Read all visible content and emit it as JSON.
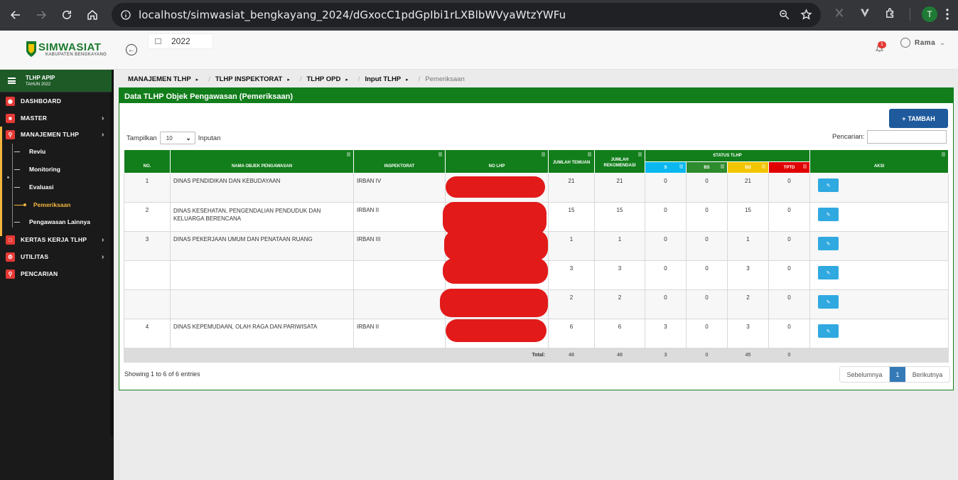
{
  "browser": {
    "url": "localhost/simwasiat_bengkayang_2024/dGxocC1pdGpIbi1rLXBlbWVyaWtzYWFu",
    "profile_initial": "T"
  },
  "header": {
    "logo_title": "SIMWASIAT",
    "logo_subtitle": "KABUPATEN BENGKAYANG",
    "year": "2022",
    "notif_count": "1",
    "user_name": "Rama"
  },
  "sidebar": {
    "head_title": "TLHP APIP",
    "head_sub": "TAHUN 2022",
    "items": [
      {
        "label": "DASHBOARD"
      },
      {
        "label": "MASTER"
      },
      {
        "label": "MANAJEMEN TLHP"
      },
      {
        "label": "KERTAS KERJA TLHP"
      },
      {
        "label": "UTILITAS"
      },
      {
        "label": "PENCARIAN"
      }
    ],
    "sub_items": [
      {
        "label": "Reviu"
      },
      {
        "label": "Monitoring"
      },
      {
        "label": "Evaluasi"
      },
      {
        "label": "Pemeriksaan"
      },
      {
        "label": "Pengawasan Lainnya"
      }
    ]
  },
  "breadcrumb": [
    "MANAJEMEN TLHP",
    "TLHP INSPEKTORAT",
    "TLHP OPD",
    "Input TLHP",
    "Pemeriksaan"
  ],
  "panel": {
    "title": "Data TLHP Objek Pengawasan (Pemeriksaan)",
    "add_label": "TAMBAH",
    "length_label_pre": "Tampilkan",
    "length_value": "10",
    "length_label_post": "Inputan",
    "search_label": "Pencarian:"
  },
  "table": {
    "headers": {
      "no": "NO.",
      "nama": "NAMA OBJEK PENGAWASAN",
      "inspektorat": "INSPEKTORAT",
      "no_lhp": "NO LHP",
      "jml_temuan": "JUMLAH TEMUAN",
      "jml_rekomendasi": "JUMLAH REKOMENDASI",
      "status": "STATUS TLHP",
      "s": "S",
      "bs": "BS",
      "bd": "BD",
      "tptd": "TPTD",
      "aksi": "AKSI"
    },
    "status_colors": {
      "s": "#0bb7ef",
      "bs": "#2e8b2e",
      "bd": "#f2c500",
      "tptd": "#e00000"
    },
    "rows": [
      {
        "no": "1",
        "nama": "DINAS PENDIDIKAN DAN KEBUDAYAAN",
        "insp": "IRBAN IV",
        "temuan": "21",
        "rekom": "21",
        "s": "0",
        "bs": "0",
        "bd": "21",
        "tptd": "0"
      },
      {
        "no": "2",
        "nama": "DINAS KESEHATAN, PENGENDALIAN PENDUDUK DAN KELUARGA BERENCANA",
        "insp": "IRBAN II",
        "temuan": "15",
        "rekom": "15",
        "s": "0",
        "bs": "0",
        "bd": "15",
        "tptd": "0"
      },
      {
        "no": "3",
        "nama": "DINAS PEKERJAAN UMUM DAN PENATAAN RUANG",
        "insp": "IRBAN III",
        "temuan": "1",
        "rekom": "1",
        "s": "0",
        "bs": "0",
        "bd": "1",
        "tptd": "0"
      },
      {
        "no": "",
        "nama": "",
        "insp": "",
        "temuan": "3",
        "rekom": "3",
        "s": "0",
        "bs": "0",
        "bd": "3",
        "tptd": "0"
      },
      {
        "no": "",
        "nama": "",
        "insp": "",
        "temuan": "2",
        "rekom": "2",
        "s": "0",
        "bs": "0",
        "bd": "2",
        "tptd": "0"
      },
      {
        "no": "4",
        "nama": "DINAS KEPEMUDAAN, OLAH RAGA DAN PARIWISATA",
        "insp": "IRBAN II",
        "temuan": "6",
        "rekom": "6",
        "s": "3",
        "bs": "0",
        "bd": "3",
        "tptd": "0"
      }
    ],
    "total": {
      "label": "Total:",
      "temuan": "48",
      "rekom": "48",
      "s": "3",
      "bs": "0",
      "bd": "45",
      "tptd": "0"
    }
  },
  "footer": {
    "info": "Showing 1 to 6 of 6 entries",
    "prev": "Sebelumnya",
    "page": "1",
    "next": "Berikutnya"
  }
}
